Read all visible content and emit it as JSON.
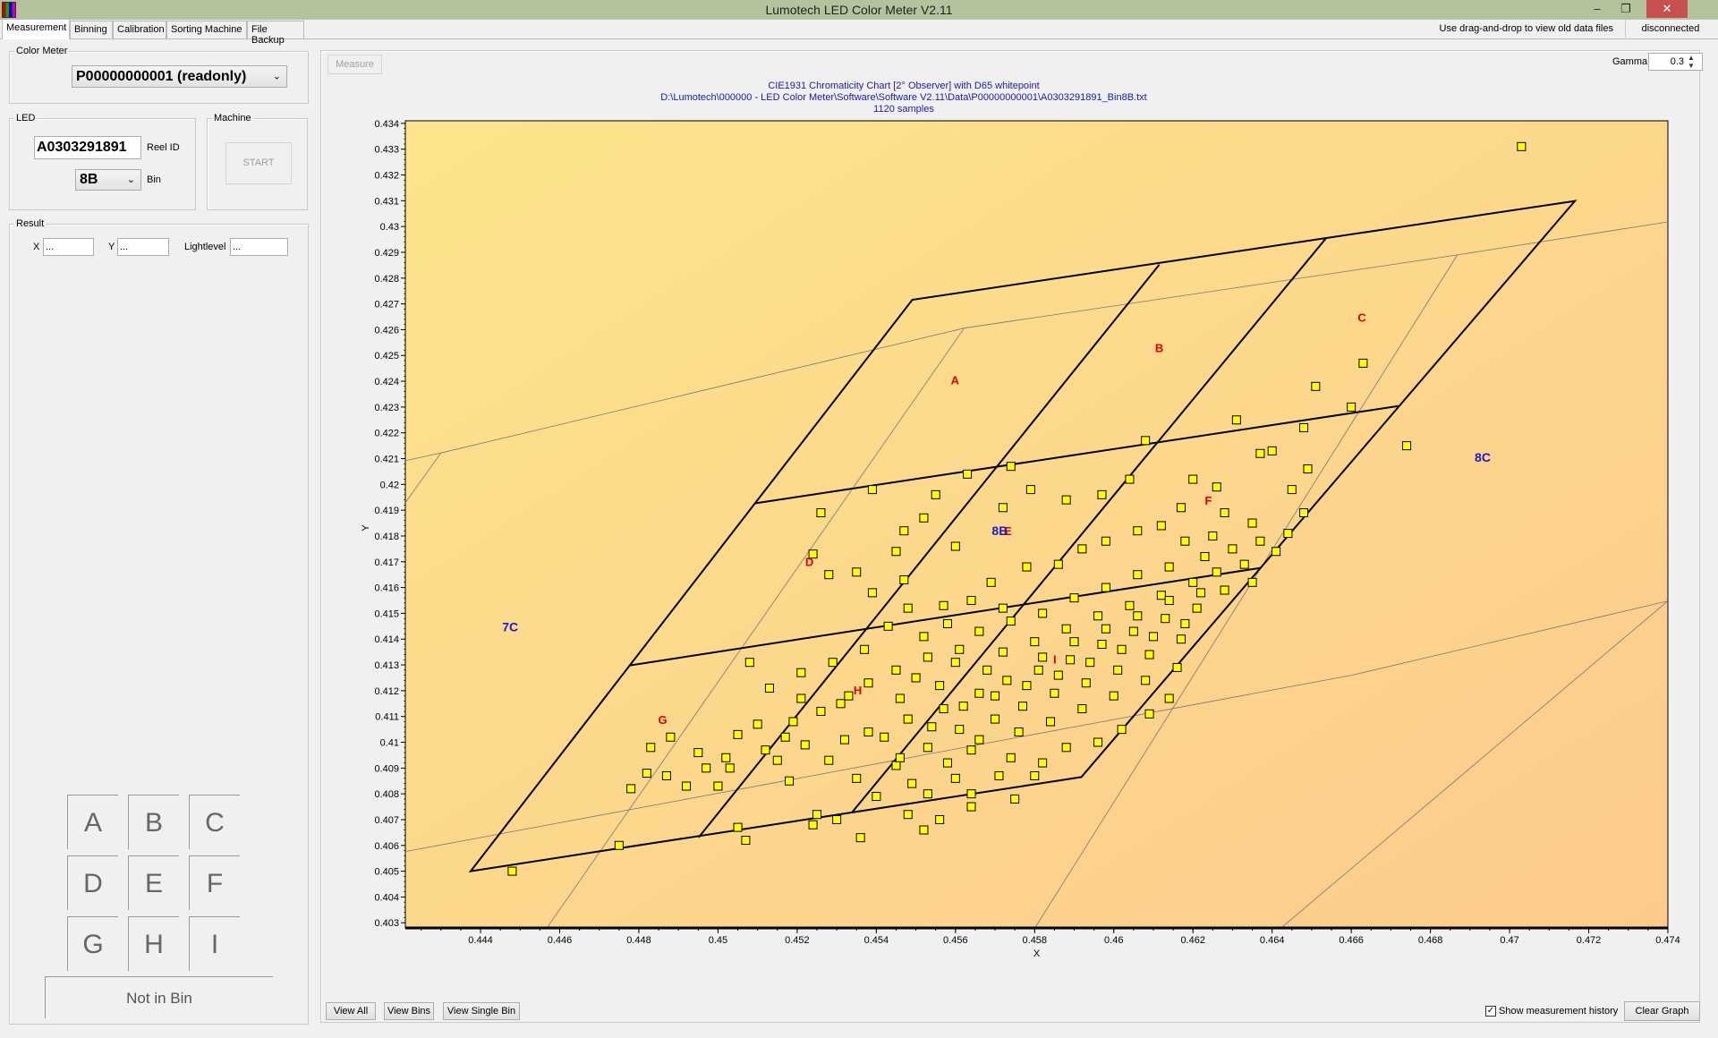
{
  "window": {
    "title": "Lumotech LED Color Meter V2.11",
    "minimize": "–",
    "maximize": "❐",
    "close": "✕"
  },
  "tabs": [
    {
      "label": "Measurement",
      "active": true
    },
    {
      "label": "Binning"
    },
    {
      "label": "Calibration"
    },
    {
      "label": "Sorting Machine"
    },
    {
      "label": "File Backup"
    }
  ],
  "status": {
    "hint": "Use drag-and-drop to view old data files",
    "connection": "disconnected"
  },
  "color_meter": {
    "label": "Color Meter",
    "selected": "P00000000001 (readonly)"
  },
  "led": {
    "label": "LED",
    "reel_id_value": "A0303291891",
    "reel_id_label": "Reel ID",
    "bin_value": "8B",
    "bin_label": "Bin"
  },
  "machine": {
    "label": "Machine",
    "start": "START"
  },
  "result": {
    "label": "Result",
    "x_label": "X",
    "x_value": "...",
    "y_label": "Y",
    "y_value": "...",
    "light_label": "Lightlevel",
    "light_value": "..."
  },
  "bin_buttons": [
    "A",
    "B",
    "C",
    "D",
    "E",
    "F",
    "G",
    "H",
    "I"
  ],
  "not_in_bin": "Not in Bin",
  "chart_panel": {
    "measure": "Measure",
    "gamma_label": "Gamma",
    "gamma_value": "0.3",
    "view_all": "View All",
    "view_bins": "View Bins",
    "view_single_bin": "View Single Bin",
    "history_label": "Show measurement history",
    "history_checked": true,
    "clear_graph": "Clear Graph"
  },
  "chart_data": {
    "type": "scatter",
    "title_lines": [
      "CIE1931 Chromaticity Chart  [2° Observer] with D65 whitepoint",
      "D:\\Lumotech\\000000 - LED Color Meter\\Software\\Software V2.11\\Data\\P00000000001\\A0303291891_Bin8B.txt",
      "1120 samples"
    ],
    "xlabel": "X",
    "ylabel": "Y",
    "xlim": [
      0.4421,
      0.474
    ],
    "ylim": [
      0.4028,
      0.4341
    ],
    "xticks": [
      0.444,
      0.446,
      0.448,
      0.45,
      0.452,
      0.454,
      0.456,
      0.458,
      0.46,
      0.462,
      0.464,
      0.466,
      0.468,
      0.47,
      0.472,
      0.474
    ],
    "xtick_labels": [
      "0.444",
      "0.446",
      "0.448",
      "0.45",
      "0.452",
      "0.454",
      "0.456",
      "0.458",
      "0.46",
      "0.462",
      "0.464",
      "0.466",
      "0.468",
      "0.47",
      "0.472",
      "0.474"
    ],
    "yticks": [
      0.403,
      0.404,
      0.405,
      0.406,
      0.407,
      0.408,
      0.409,
      0.41,
      0.411,
      0.412,
      0.413,
      0.414,
      0.415,
      0.416,
      0.417,
      0.418,
      0.419,
      0.42,
      0.421,
      0.422,
      0.423,
      0.424,
      0.425,
      0.426,
      0.427,
      0.428,
      0.429,
      0.43,
      0.431,
      0.432,
      0.433,
      0.434
    ],
    "ytick_labels": [
      "0.403",
      "0.404",
      "0.405",
      "0.406",
      "0.407",
      "0.408",
      "0.409",
      "0.41",
      "0.411",
      "0.412",
      "0.413",
      "0.414",
      "0.415",
      "0.416",
      "0.417",
      "0.418",
      "0.419",
      "0.42",
      "0.421",
      "0.422",
      "0.423",
      "0.424",
      "0.425",
      "0.426",
      "0.427",
      "0.428",
      "0.429",
      "0.43",
      "0.431",
      "0.432",
      "0.433",
      "0.434"
    ],
    "colors": {
      "bg_start": "#fde48c",
      "bg_end": "#fccb8c",
      "point_fill": "#ffff00",
      "point_stroke": "#000000",
      "sub_bin_label": "#e00000",
      "bin_label": "#1a1ad0"
    },
    "bin_outline": [
      [
        0.44375,
        0.405
      ],
      [
        0.45491,
        0.42716
      ],
      [
        0.47165,
        0.43099
      ],
      [
        0.45918,
        0.40865
      ]
    ],
    "bin_dividers": [
      [
        [
          0.45095,
          0.41927
        ],
        [
          0.46719,
          0.42304
        ]
      ],
      [
        [
          0.44777,
          0.41298
        ],
        [
          0.4637,
          0.41676
        ]
      ],
      [
        [
          0.44951,
          0.40631
        ],
        [
          0.46115,
          0.42852
        ]
      ],
      [
        [
          0.45339,
          0.40729
        ],
        [
          0.46536,
          0.42954
        ]
      ]
    ],
    "neighbor_lines": [
      [
        [
          0.44209,
          0.42092
        ],
        [
          0.443,
          0.42122
        ],
        [
          0.45622,
          0.42606
        ],
        [
          0.46868,
          0.4289
        ],
        [
          0.474,
          0.43018
        ]
      ],
      [
        [
          0.44209,
          0.41927
        ],
        [
          0.443,
          0.42122
        ]
      ],
      [
        [
          0.44569,
          0.40283
        ],
        [
          0.45622,
          0.42606
        ]
      ],
      [
        [
          0.45802,
          0.40283
        ],
        [
          0.46868,
          0.4289
        ]
      ],
      [
        [
          0.46425,
          0.40283
        ],
        [
          0.474,
          0.41548
        ]
      ],
      [
        [
          0.44209,
          0.40576
        ],
        [
          0.46601,
          0.4126
        ],
        [
          0.474,
          0.41548
        ]
      ]
    ],
    "sub_bin_labels": [
      {
        "text": "A",
        "x": 0.45599,
        "y": 0.42406
      },
      {
        "text": "B",
        "x": 0.46115,
        "y": 0.4253
      },
      {
        "text": "C",
        "x": 0.46627,
        "y": 0.42648
      },
      {
        "text": "D",
        "x": 0.45231,
        "y": 0.41701
      },
      {
        "text": "E",
        "x": 0.45732,
        "y": 0.4182
      },
      {
        "text": "F",
        "x": 0.46239,
        "y": 0.41939
      },
      {
        "text": "G",
        "x": 0.4486,
        "y": 0.41088
      },
      {
        "text": "H",
        "x": 0.45353,
        "y": 0.41203
      },
      {
        "text": "I",
        "x": 0.45851,
        "y": 0.41322
      }
    ],
    "bin_labels": [
      {
        "text": "8B",
        "x": 0.45712,
        "y": 0.4182
      },
      {
        "text": "7C",
        "x": 0.44475,
        "y": 0.41447
      },
      {
        "text": "8C",
        "x": 0.46932,
        "y": 0.42105
      }
    ],
    "points": [
      [
        0.4703,
        0.4331
      ],
      [
        0.4448,
        0.405
      ],
      [
        0.4475,
        0.406
      ],
      [
        0.458,
        0.4087
      ],
      [
        0.4651,
        0.4238
      ],
      [
        0.4663,
        0.4247
      ],
      [
        0.466,
        0.423
      ],
      [
        0.4674,
        0.4215
      ],
      [
        0.4648,
        0.4222
      ],
      [
        0.464,
        0.4213
      ],
      [
        0.4631,
        0.4225
      ],
      [
        0.4608,
        0.4217
      ],
      [
        0.4574,
        0.4207
      ],
      [
        0.4563,
        0.4204
      ],
      [
        0.4572,
        0.4191
      ],
      [
        0.4539,
        0.4198
      ],
      [
        0.4526,
        0.4189
      ],
      [
        0.4524,
        0.4173
      ],
      [
        0.4547,
        0.4182
      ],
      [
        0.456,
        0.4176
      ],
      [
        0.4545,
        0.4174
      ],
      [
        0.4552,
        0.4187
      ],
      [
        0.4555,
        0.4196
      ],
      [
        0.4579,
        0.4198
      ],
      [
        0.4588,
        0.4194
      ],
      [
        0.4597,
        0.4196
      ],
      [
        0.4604,
        0.4202
      ],
      [
        0.462,
        0.4202
      ],
      [
        0.4626,
        0.4199
      ],
      [
        0.4637,
        0.4212
      ],
      [
        0.4645,
        0.4198
      ],
      [
        0.4649,
        0.4206
      ],
      [
        0.4648,
        0.4189
      ],
      [
        0.4628,
        0.4189
      ],
      [
        0.4617,
        0.4191
      ],
      [
        0.4625,
        0.418
      ],
      [
        0.4635,
        0.4185
      ],
      [
        0.4478,
        0.4082
      ],
      [
        0.4482,
        0.4088
      ],
      [
        0.4487,
        0.4087
      ],
      [
        0.4492,
        0.4083
      ],
      [
        0.4497,
        0.409
      ],
      [
        0.45,
        0.4083
      ],
      [
        0.4502,
        0.4094
      ],
      [
        0.4505,
        0.4103
      ],
      [
        0.451,
        0.4107
      ],
      [
        0.4503,
        0.409
      ],
      [
        0.4512,
        0.4097
      ],
      [
        0.4507,
        0.4062
      ],
      [
        0.4505,
        0.4067
      ],
      [
        0.4524,
        0.4068
      ],
      [
        0.4525,
        0.4072
      ],
      [
        0.453,
        0.407
      ],
      [
        0.4536,
        0.4063
      ],
      [
        0.4548,
        0.4072
      ],
      [
        0.4552,
        0.4066
      ],
      [
        0.4556,
        0.407
      ],
      [
        0.4564,
        0.4075
      ],
      [
        0.4575,
        0.4078
      ],
      [
        0.4564,
        0.408
      ],
      [
        0.4515,
        0.4093
      ],
      [
        0.4518,
        0.4085
      ],
      [
        0.4522,
        0.4099
      ],
      [
        0.4528,
        0.4093
      ],
      [
        0.4532,
        0.4101
      ],
      [
        0.4535,
        0.4086
      ],
      [
        0.454,
        0.4079
      ],
      [
        0.4545,
        0.4091
      ],
      [
        0.4549,
        0.4084
      ],
      [
        0.4519,
        0.4108
      ],
      [
        0.4526,
        0.4112
      ],
      [
        0.4531,
        0.4115
      ],
      [
        0.4513,
        0.4121
      ],
      [
        0.4508,
        0.4131
      ],
      [
        0.4521,
        0.4127
      ],
      [
        0.4529,
        0.4131
      ],
      [
        0.4537,
        0.4136
      ],
      [
        0.4543,
        0.4145
      ],
      [
        0.4552,
        0.4141
      ],
      [
        0.4539,
        0.4158
      ],
      [
        0.4528,
        0.4165
      ],
      [
        0.4535,
        0.4166
      ],
      [
        0.4547,
        0.4163
      ],
      [
        0.4557,
        0.4153
      ],
      [
        0.4564,
        0.4155
      ],
      [
        0.4569,
        0.4162
      ],
      [
        0.4578,
        0.4168
      ],
      [
        0.4586,
        0.4169
      ],
      [
        0.4592,
        0.4175
      ],
      [
        0.4598,
        0.4178
      ],
      [
        0.4606,
        0.4182
      ],
      [
        0.4612,
        0.4184
      ],
      [
        0.4618,
        0.4178
      ],
      [
        0.4542,
        0.4102
      ],
      [
        0.4548,
        0.4109
      ],
      [
        0.4553,
        0.4098
      ],
      [
        0.4557,
        0.4113
      ],
      [
        0.4561,
        0.4105
      ],
      [
        0.4566,
        0.4119
      ],
      [
        0.457,
        0.4109
      ],
      [
        0.4573,
        0.4124
      ],
      [
        0.4577,
        0.4114
      ],
      [
        0.4581,
        0.4128
      ],
      [
        0.4585,
        0.4119
      ],
      [
        0.4589,
        0.4132
      ],
      [
        0.4593,
        0.4123
      ],
      [
        0.4597,
        0.4138
      ],
      [
        0.4601,
        0.4128
      ],
      [
        0.4605,
        0.4143
      ],
      [
        0.4609,
        0.4134
      ],
      [
        0.4613,
        0.4148
      ],
      [
        0.4617,
        0.414
      ],
      [
        0.4621,
        0.4152
      ],
      [
        0.4556,
        0.4122
      ],
      [
        0.456,
        0.4131
      ],
      [
        0.4564,
        0.4097
      ],
      [
        0.4568,
        0.4128
      ],
      [
        0.4572,
        0.4135
      ],
      [
        0.4576,
        0.4104
      ],
      [
        0.458,
        0.4139
      ],
      [
        0.4584,
        0.4108
      ],
      [
        0.4588,
        0.4144
      ],
      [
        0.4592,
        0.4113
      ],
      [
        0.4596,
        0.4149
      ],
      [
        0.46,
        0.4118
      ],
      [
        0.4604,
        0.4153
      ],
      [
        0.4608,
        0.4124
      ],
      [
        0.4612,
        0.4157
      ],
      [
        0.4616,
        0.4129
      ],
      [
        0.462,
        0.4162
      ],
      [
        0.4546,
        0.4117
      ],
      [
        0.455,
        0.4125
      ],
      [
        0.4554,
        0.4106
      ],
      [
        0.4558,
        0.4092
      ],
      [
        0.4562,
        0.4114
      ],
      [
        0.4566,
        0.4101
      ],
      [
        0.457,
        0.4118
      ],
      [
        0.4574,
        0.4094
      ],
      [
        0.4578,
        0.4122
      ],
      [
        0.4582,
        0.4133
      ],
      [
        0.4586,
        0.4126
      ],
      [
        0.459,
        0.4139
      ],
      [
        0.4594,
        0.4131
      ],
      [
        0.4598,
        0.4144
      ],
      [
        0.4602,
        0.4136
      ],
      [
        0.4606,
        0.4149
      ],
      [
        0.461,
        0.4141
      ],
      [
        0.4614,
        0.4155
      ],
      [
        0.4618,
        0.4146
      ],
      [
        0.4622,
        0.4158
      ],
      [
        0.4574,
        0.4147
      ],
      [
        0.4582,
        0.415
      ],
      [
        0.459,
        0.4156
      ],
      [
        0.4598,
        0.416
      ],
      [
        0.4606,
        0.4165
      ],
      [
        0.4614,
        0.4168
      ],
      [
        0.4623,
        0.4172
      ],
      [
        0.463,
        0.4175
      ],
      [
        0.4637,
        0.4178
      ],
      [
        0.4626,
        0.4166
      ],
      [
        0.4633,
        0.4169
      ],
      [
        0.4641,
        0.4174
      ],
      [
        0.4644,
        0.4181
      ],
      [
        0.4628,
        0.4159
      ],
      [
        0.4635,
        0.4162
      ],
      [
        0.4566,
        0.4143
      ],
      [
        0.4572,
        0.4152
      ],
      [
        0.4561,
        0.4136
      ],
      [
        0.4553,
        0.4133
      ],
      [
        0.4545,
        0.4128
      ],
      [
        0.4538,
        0.4123
      ],
      [
        0.4533,
        0.4118
      ],
      [
        0.4548,
        0.4152
      ],
      [
        0.4558,
        0.4146
      ],
      [
        0.4602,
        0.4105
      ],
      [
        0.4596,
        0.41
      ],
      [
        0.4588,
        0.4098
      ],
      [
        0.4609,
        0.4111
      ],
      [
        0.4614,
        0.4117
      ],
      [
        0.4582,
        0.4092
      ],
      [
        0.4571,
        0.4087
      ],
      [
        0.456,
        0.4086
      ],
      [
        0.4553,
        0.408
      ],
      [
        0.4546,
        0.4094
      ],
      [
        0.4538,
        0.4104
      ],
      [
        0.4521,
        0.4117
      ],
      [
        0.4517,
        0.4102
      ],
      [
        0.4495,
        0.4096
      ],
      [
        0.4488,
        0.4102
      ],
      [
        0.4483,
        0.4098
      ]
    ]
  }
}
